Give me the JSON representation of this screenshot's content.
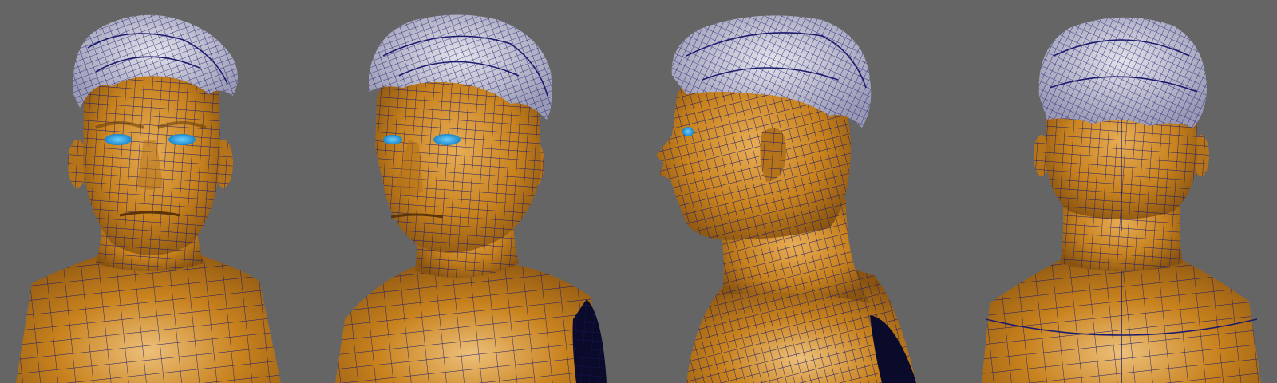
{
  "scene": {
    "viewport_background": "#656565",
    "subject": "wireframe-head-bust",
    "views": [
      {
        "id": "front",
        "kind": "front-view"
      },
      {
        "id": "three-quarter",
        "kind": "three-quarter-view"
      },
      {
        "id": "side",
        "kind": "side-profile-view"
      },
      {
        "id": "back",
        "kind": "back-view"
      }
    ]
  },
  "colors": {
    "skin": "#c8821e",
    "skin_light": "#e3a64a",
    "skin_dark": "#8a5410",
    "wire": "#1c1a6e",
    "hair": "#c9c9d3",
    "hair_dark": "#7f80a0",
    "eye": "#2aa6e6",
    "inner_mesh": "#0a0a2a"
  }
}
